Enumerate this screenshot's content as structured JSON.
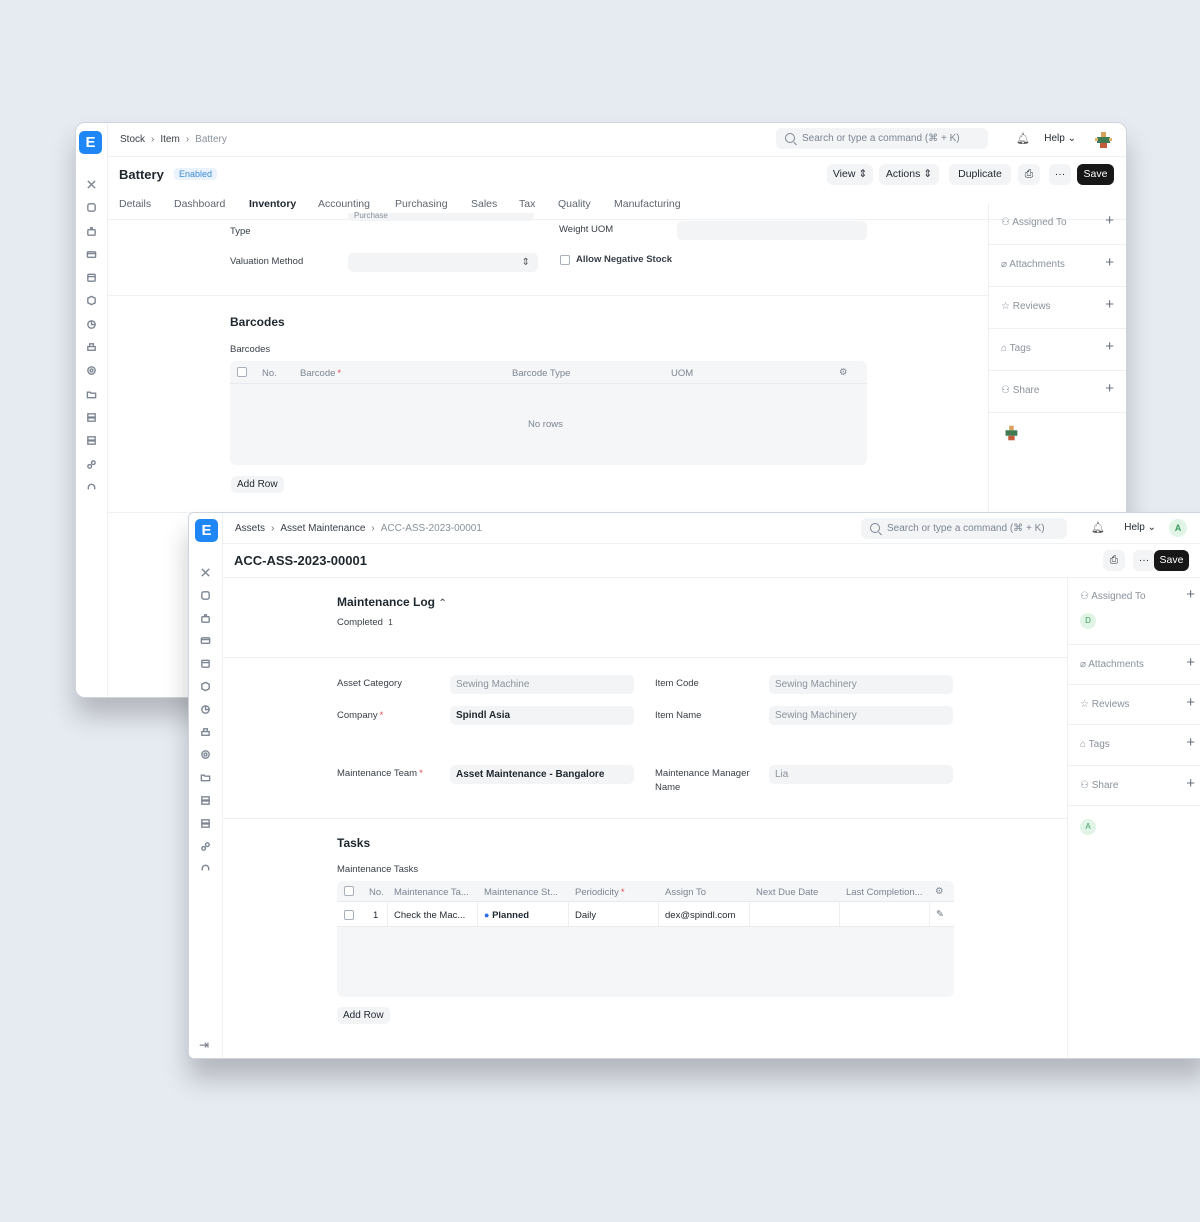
{
  "back_window": {
    "breadcrumbs": [
      "Stock",
      "Item",
      "Battery"
    ],
    "search_placeholder": "Search or type a command (⌘ + K)",
    "help_label": "Help",
    "title": "Battery",
    "status_badge": "Enabled",
    "buttons": {
      "view": "View",
      "actions": "Actions",
      "duplicate": "Duplicate",
      "save": "Save"
    },
    "tabs": [
      "Details",
      "Dashboard",
      "Inventory",
      "Accounting",
      "Purchasing",
      "Sales",
      "Tax",
      "Quality",
      "Manufacturing"
    ],
    "active_tab": "Inventory",
    "fields": {
      "cut_label": "Type",
      "cut_value": "Purchase",
      "weight_uom_label": "Weight UOM",
      "valuation_method_label": "Valuation Method",
      "allow_negative_stock_label": "Allow Negative Stock"
    },
    "barcodes": {
      "section_title": "Barcodes",
      "table_label": "Barcodes",
      "columns": [
        "No.",
        "Barcode",
        "Barcode Type",
        "UOM"
      ],
      "empty_text": "No rows",
      "add_row": "Add Row"
    },
    "sidebar": [
      "Assigned To",
      "Attachments",
      "Reviews",
      "Tags",
      "Share"
    ]
  },
  "front_window": {
    "breadcrumbs": [
      "Assets",
      "Asset Maintenance",
      "ACC-ASS-2023-00001"
    ],
    "search_placeholder": "Search or type a command (⌘ + K)",
    "help_label": "Help",
    "avatar_initial": "A",
    "title": "ACC-ASS-2023-00001",
    "buttons": {
      "save": "Save"
    },
    "maintenance_log": {
      "title": "Maintenance Log",
      "completed_label": "Completed",
      "completed_count": "1"
    },
    "fields": {
      "asset_category_label": "Asset Category",
      "asset_category_value": "Sewing Machine",
      "item_code_label": "Item Code",
      "item_code_value": "Sewing Machinery",
      "company_label": "Company",
      "company_value": "Spindl Asia",
      "item_name_label": "Item Name",
      "item_name_value": "Sewing Machinery",
      "maintenance_team_label": "Maintenance Team",
      "maintenance_team_value": "Asset Maintenance - Bangalore",
      "maintenance_manager_label_1": "Maintenance Manager",
      "maintenance_manager_label_2": "Name",
      "maintenance_manager_value": "Lia"
    },
    "tasks": {
      "section_title": "Tasks",
      "table_label": "Maintenance Tasks",
      "columns": [
        "No.",
        "Maintenance Ta...",
        "Maintenance St...",
        "Periodicity",
        "Assign To",
        "Next Due Date",
        "Last Completion..."
      ],
      "rows": [
        {
          "no": "1",
          "task": "Check the Mac...",
          "status": "Planned",
          "periodicity": "Daily",
          "assign_to": "dex@spindl.com",
          "next_due": "",
          "last_completion": ""
        }
      ],
      "add_row": "Add Row"
    },
    "sidebar": [
      "Assigned To",
      "Attachments",
      "Reviews",
      "Tags",
      "Share"
    ],
    "assigned_initial": "D",
    "share_initial": "A"
  },
  "colors": {
    "accent": "#1f87f5",
    "save_button": "#171717",
    "status_planned": "#2d6ee8",
    "required": "#e24c4c"
  }
}
